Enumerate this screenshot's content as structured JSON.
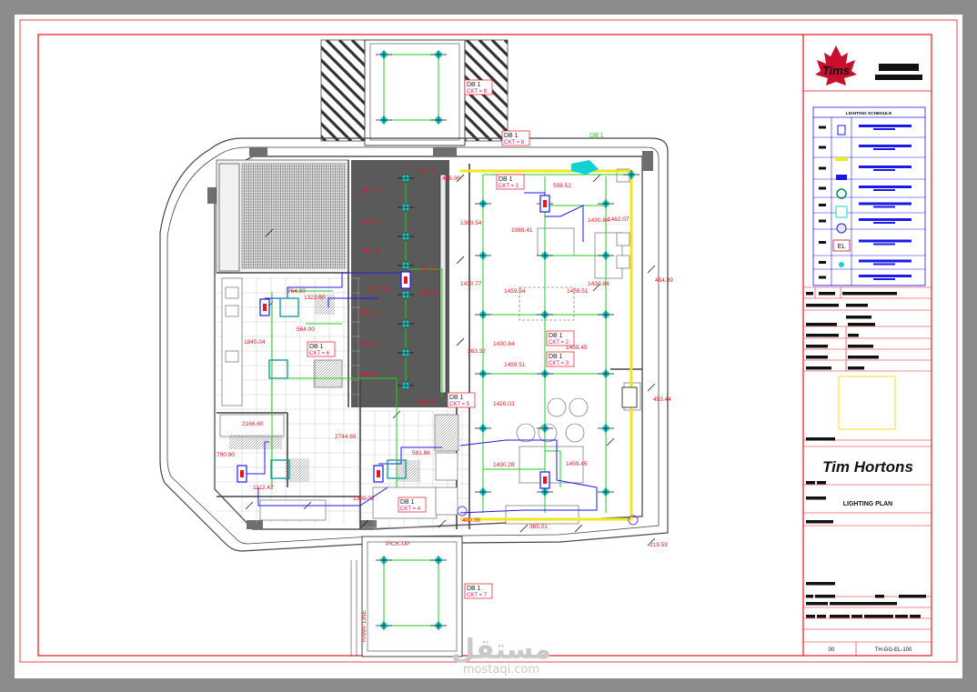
{
  "colors": {
    "paper": "#ffffff",
    "background": "#8c8c8c",
    "border": "#e8141e",
    "wall": "#6e6e6e",
    "wire_green": "#22cc22",
    "wire_blue": "#1a1ae8",
    "fixture_cyan": "#14d2d2",
    "yellow_line": "#f2e61e",
    "dark_zone": "#5a5a5a",
    "tims_red": "#c8102e"
  },
  "title_block": {
    "logo_top": "Tims",
    "brand": "Tim Hortons",
    "drawing_title": "LIGHTING PLAN",
    "schedule_title": "LIGHTING SCHEDULE",
    "revision": "00",
    "drawing_number": "TH-GG-EL-100"
  },
  "legend": {
    "symbols": [
      "EL"
    ]
  },
  "panels": [
    {
      "label": "DB 1",
      "circuit": "CKT = 8"
    },
    {
      "label": "DB 1",
      "circuit": "CKT = 8"
    },
    {
      "label": "DB 1",
      "circuit": "CKT = 1"
    },
    {
      "label": "DB 1",
      "circuit": "CKT = 6"
    },
    {
      "label": "DB 1",
      "circuit": "CKT = 2"
    },
    {
      "label": "DB 1",
      "circuit": "CKT = 3"
    },
    {
      "label": "DB 1",
      "circuit": "CKT = 5"
    },
    {
      "label": "DB 1",
      "circuit": "CKT = 4"
    },
    {
      "label": "DB 1",
      "circuit": "CKT = 7"
    }
  ],
  "db_tag": "DB 1",
  "dimensions": [
    "458.76",
    "466.06",
    "457.42",
    "673.22",
    "457.48",
    "531.12",
    "1389.54",
    "1088.41",
    "508.52",
    "1430.84",
    "1462.07",
    "1274.54",
    "500.75",
    "457.00",
    "673.29",
    "440.17",
    "1430.77",
    "1459.54",
    "1459.51",
    "1430.84",
    "764.00",
    "1322.60",
    "1845.04",
    "564.00",
    "363.32",
    "1430.84",
    "1459.45",
    "1459.51",
    "1426.03",
    "316.92",
    "453.44",
    "2166.60",
    "2744.60",
    "581.86",
    "790.90",
    "1112.42",
    "1430.28",
    "1459.45",
    "1389.02",
    "400.38",
    "365.01",
    "454.89",
    "219.59"
  ],
  "watermark": {
    "arabic": "مستقل",
    "latin": "mostaqi.com"
  },
  "stair_labels": [
    "PICK-UP",
    "RAMP LINE"
  ]
}
